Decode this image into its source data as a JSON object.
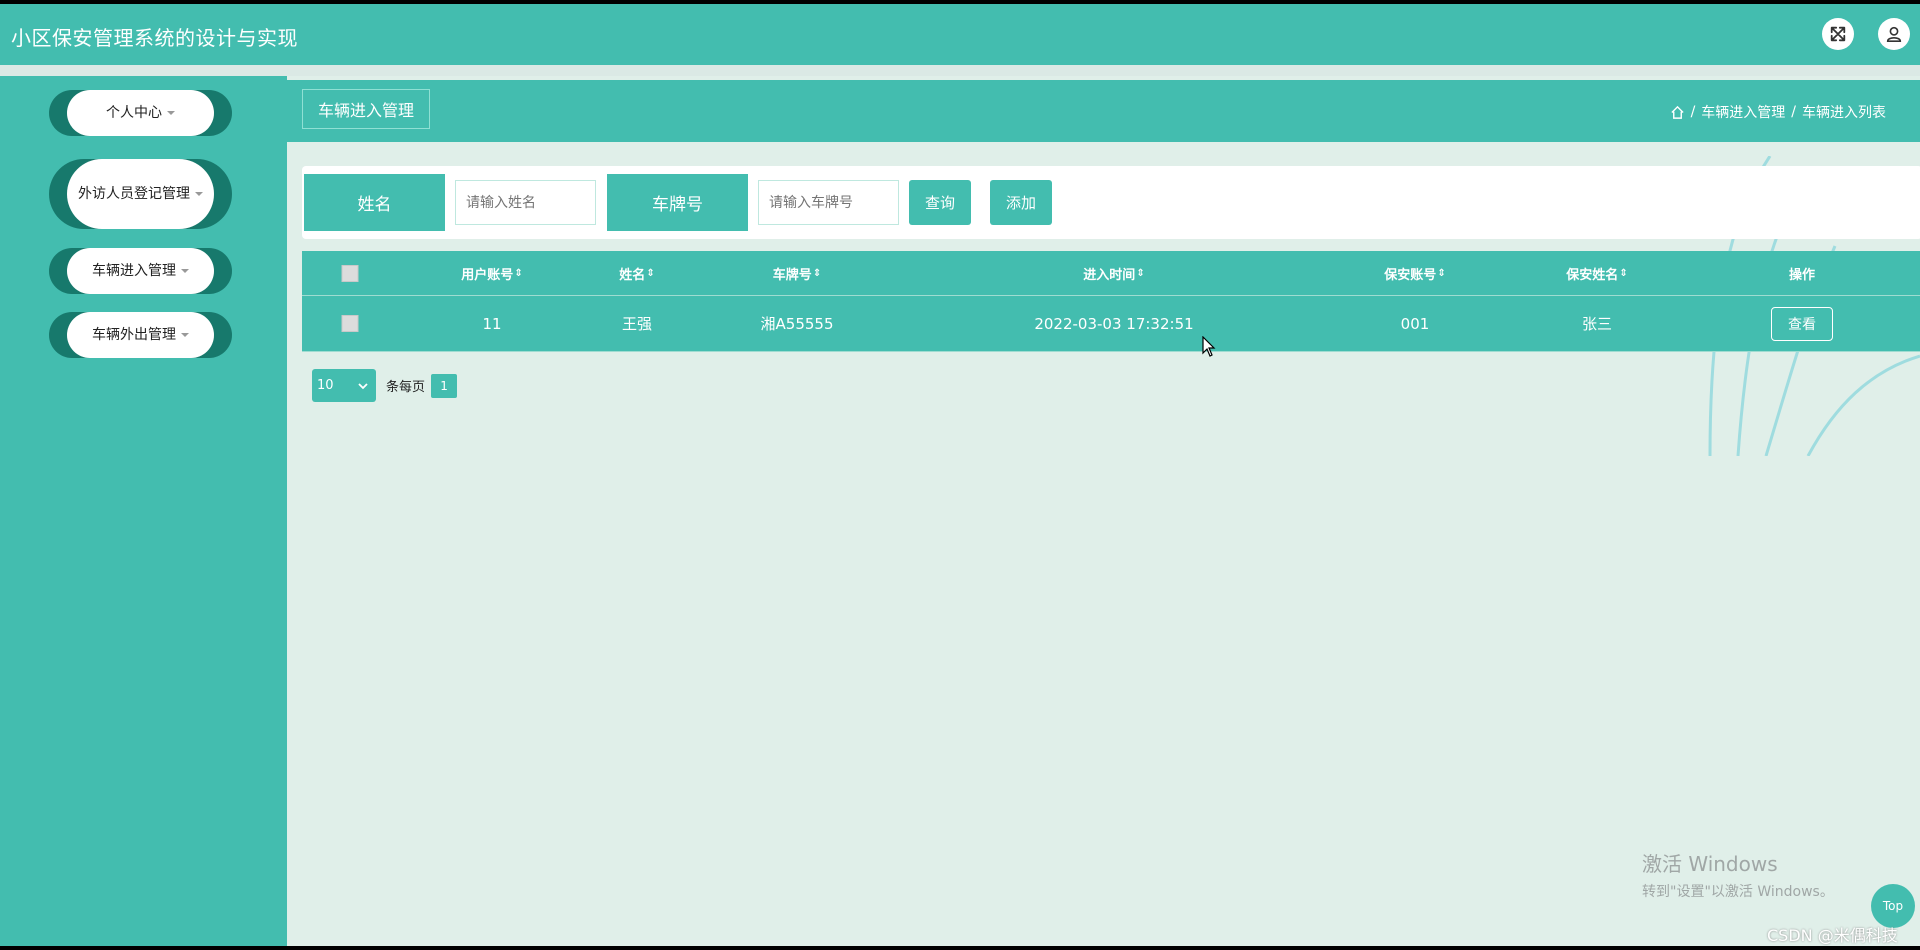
{
  "header": {
    "title": "小区保安管理系统的设计与实现",
    "icons": [
      "fullscreen-icon",
      "user-icon"
    ]
  },
  "sidebar": {
    "items": [
      {
        "label": "个人中心"
      },
      {
        "label": "外访人员登记管理"
      },
      {
        "label": "车辆进入管理"
      },
      {
        "label": "车辆外出管理"
      }
    ]
  },
  "breadcrumb": {
    "title": "车辆进入管理",
    "path": [
      "车辆进入管理",
      "车辆进入列表"
    ],
    "separator": "/"
  },
  "search": {
    "name_label": "姓名",
    "name_placeholder": "请输入姓名",
    "plate_label": "车牌号",
    "plate_placeholder": "请输入车牌号",
    "query_button": "查询",
    "add_button": "添加"
  },
  "table": {
    "columns": [
      "用户账号",
      "姓名",
      "车牌号",
      "进入时间",
      "保安账号",
      "保安姓名",
      "操作"
    ],
    "sort_icon": "⇕",
    "rows": [
      {
        "user_account": "11",
        "name": "王强",
        "plate": "湘A55555",
        "entry_time": "2022-03-03 17:32:51",
        "guard_account": "001",
        "guard_name": "张三",
        "action": "查看"
      }
    ]
  },
  "pagination": {
    "page_size": "10",
    "per_page_label": "条每页",
    "current_page": "1"
  },
  "overlay": {
    "watermark_line1": "激活 Windows",
    "watermark_line2": "转到\"设置\"以激活 Windows。",
    "top_button": "Top",
    "csdn": "CSDN @米偶科技"
  },
  "colors": {
    "primary": "#43bdaf",
    "sidebar_pill_dark": "#17796c",
    "background": "#e0efe9"
  }
}
